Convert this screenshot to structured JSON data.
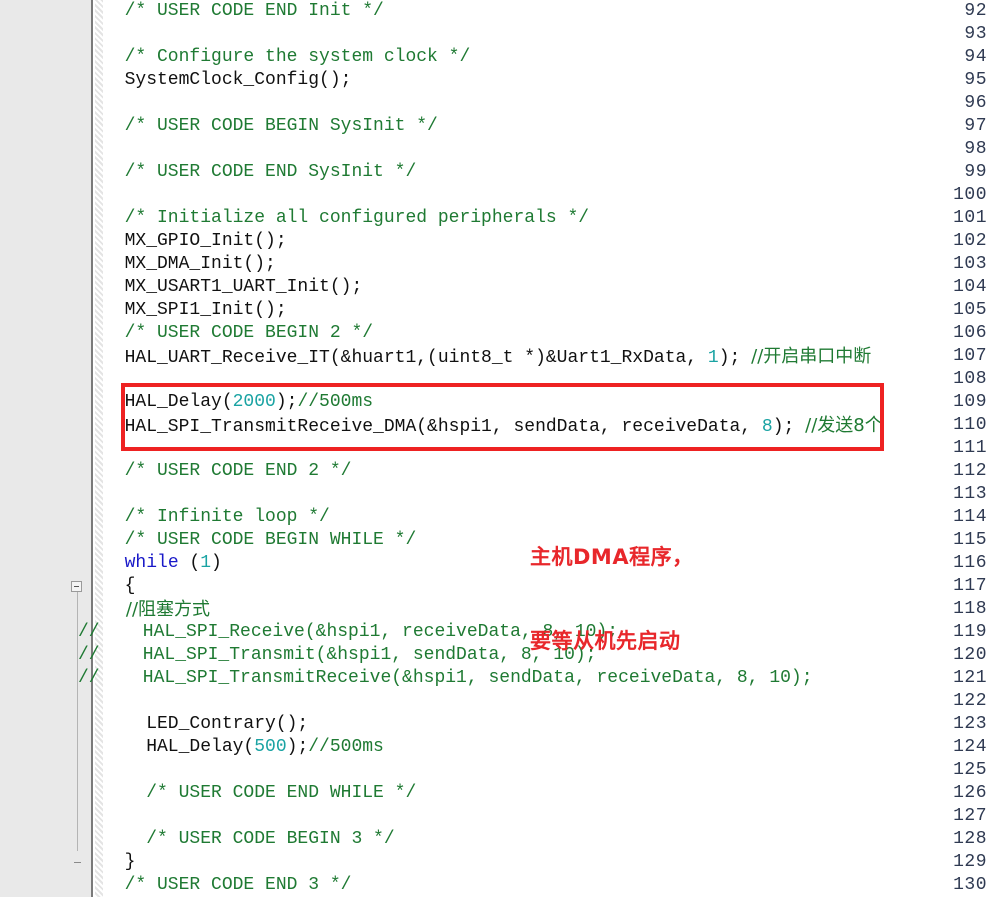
{
  "editor": {
    "first_line": 92,
    "last_line": 130,
    "line_height": 23,
    "colors": {
      "comment": "#1f7a33",
      "number": "#1aa3a3",
      "keyword": "#1919c8",
      "code": "#111111",
      "line_number": "#2f3a52",
      "gutter_background": "#e9e9e9",
      "highlight_box": "#ee2222",
      "annotation": "#e8272b"
    }
  },
  "line_numbers": [
    "92",
    "93",
    "94",
    "95",
    "96",
    "97",
    "98",
    "99",
    "100",
    "101",
    "102",
    "103",
    "104",
    "105",
    "106",
    "107",
    "108",
    "109",
    "110",
    "111",
    "112",
    "113",
    "114",
    "115",
    "116",
    "117",
    "118",
    "119",
    "120",
    "121",
    "122",
    "123",
    "124",
    "125",
    "126",
    "127",
    "128",
    "129",
    "130"
  ],
  "lines": {
    "l92": "  /* USER CODE END Init */",
    "l93": "",
    "l94": "  /* Configure the system clock */",
    "l95a": "  SystemClock_Config();",
    "l96": "",
    "l97": "  /* USER CODE BEGIN SysInit */",
    "l98": "",
    "l99": "  /* USER CODE END SysInit */",
    "l100": "",
    "l101": "  /* Initialize all configured peripherals */",
    "l102": "  MX_GPIO_Init();",
    "l103": "  MX_DMA_Init();",
    "l104": "  MX_USART1_UART_Init();",
    "l105": "  MX_SPI1_Init();",
    "l106": "  /* USER CODE BEGIN 2 */",
    "l107_code": "  HAL_UART_Receive_IT(&huart1,(uint8_t *)&Uart1_RxData, ",
    "l107_num": "1",
    "l107_tail": "); ",
    "l107_comment": "//开启串口中断",
    "l108": "",
    "l109_code": "  HAL_Delay(",
    "l109_num": "2000",
    "l109_tail": ");",
    "l109_comment": "//500ms",
    "l110_code": "  HAL_SPI_TransmitReceive_DMA(&hspi1, sendData, receiveData, ",
    "l110_num": "8",
    "l110_tail": "); ",
    "l110_comment": "//发送8个",
    "l111": "",
    "l112": "  /* USER CODE END 2 */",
    "l113": "",
    "l114": "  /* Infinite loop */",
    "l115": "  /* USER CODE BEGIN WHILE */",
    "l116_kw": "while",
    "l116_pre": "  ",
    "l116_mid": " (",
    "l116_num": "1",
    "l116_tail": ")",
    "l117": "  {",
    "l118": "    //阻塞方式",
    "l119": "//    HAL_SPI_Receive(&hspi1, receiveData, 8, 10);",
    "l120": "//    HAL_SPI_Transmit(&hspi1, sendData, 8, 10);",
    "l121": "//    HAL_SPI_TransmitReceive(&hspi1, sendData, receiveData, 8, 10);",
    "l122": "",
    "l123": "    LED_Contrary();",
    "l124_code": "    HAL_Delay(",
    "l124_num": "500",
    "l124_tail": ");",
    "l124_comment": "//500ms",
    "l125": "",
    "l126": "    /* USER CODE END WHILE */",
    "l127": "",
    "l128": "    /* USER CODE BEGIN 3 */",
    "l129": "  }",
    "l130": "  /* USER CODE END 3 */"
  },
  "annotation": {
    "line1": "主机DMA程序，",
    "line2": "要等从机先启动"
  },
  "highlight_box": {
    "covers_lines": "109-110",
    "label": "highlighted-code-region"
  },
  "fold_markers": {
    "open_at_line": "117",
    "close_at_line": "129"
  }
}
